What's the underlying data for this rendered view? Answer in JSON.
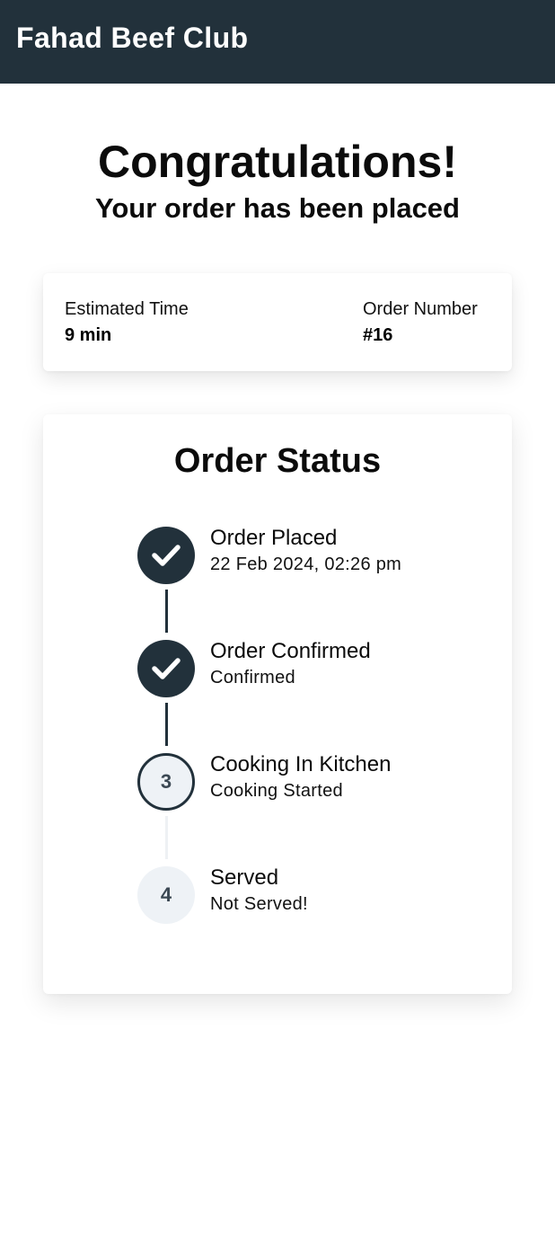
{
  "header": {
    "brand": "Fahad Beef Club",
    "background": "#22313b"
  },
  "hero": {
    "title": "Congratulations!",
    "subtitle": "Your order has been placed"
  },
  "order_info": {
    "estimated_time_label": "Estimated Time",
    "estimated_time_value": "9 min",
    "order_number_label": "Order Number",
    "order_number_value": "#16"
  },
  "order_status": {
    "title": "Order Status",
    "steps": [
      {
        "number": "1",
        "state": "done",
        "icon": "check-icon",
        "title": "Order Placed",
        "subtitle": "22 Feb 2024, 02:26 pm"
      },
      {
        "number": "2",
        "state": "done",
        "icon": "check-icon",
        "title": "Order Confirmed",
        "subtitle": "Confirmed"
      },
      {
        "number": "3",
        "state": "current",
        "title": "Cooking In Kitchen",
        "subtitle": "Cooking Started"
      },
      {
        "number": "4",
        "state": "pending",
        "title": "Served",
        "subtitle": "Not Served!"
      }
    ]
  },
  "colors": {
    "accent": "#22313b",
    "pending_circle": "#eef2f6",
    "pending_number": "#3b4853"
  }
}
